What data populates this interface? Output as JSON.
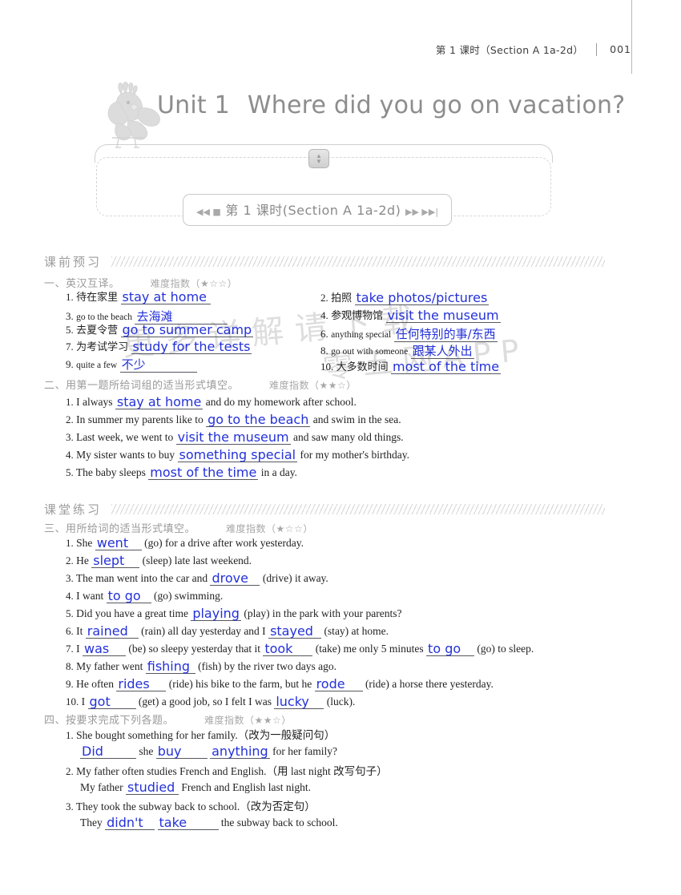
{
  "runhead": {
    "title": "第 1 课时（Section A 1a-2d）",
    "page_number": "001"
  },
  "banner": {
    "unit_number": "Unit 1",
    "unit_title": "Where did you go on vacation?",
    "lesson_pill": "第 1 课时(Section A 1a-2d)",
    "nav_left": "◀◀ ■",
    "nav_right": "▶▶ ▶▶|",
    "bird_icon": "cockatoo-illustration"
  },
  "watermark": {
    "line1": "更多详解请下载",
    "line2": "零五网APP"
  },
  "sections": [
    {
      "label": "课前预习"
    },
    {
      "label": "课堂练习"
    }
  ],
  "parts": [
    {
      "heading": "一、英汉互译。",
      "difficulty": "难度指数（★☆☆）",
      "items_left": [
        {
          "num": "1.",
          "prompt": "待在家里",
          "prompt_style": "cn",
          "answer": "stay at home",
          "answer_style": "en"
        },
        {
          "num": "3.",
          "prompt": "go to the beach",
          "prompt_style": "en-small",
          "answer": "去海滩",
          "answer_style": "cn"
        },
        {
          "num": "5.",
          "prompt": "去夏令营",
          "prompt_style": "cn",
          "answer": "go to summer camp",
          "answer_style": "en"
        },
        {
          "num": "7.",
          "prompt": "为考试学习",
          "prompt_style": "cn",
          "answer": "study for the tests",
          "answer_style": "en"
        },
        {
          "num": "9.",
          "prompt": "quite a few",
          "prompt_style": "en-small",
          "answer": "不少",
          "answer_style": "cn"
        }
      ],
      "items_right": [
        {
          "num": "2.",
          "prompt": "拍照",
          "prompt_style": "cn",
          "answer": "take photos/pictures",
          "answer_style": "en"
        },
        {
          "num": "4.",
          "prompt": "参观博物馆",
          "prompt_style": "cn",
          "answer": "visit the museum",
          "answer_style": "en"
        },
        {
          "num": "6.",
          "prompt": "anything special",
          "prompt_style": "en-small",
          "answer": "任何特别的事/东西",
          "answer_style": "cn"
        },
        {
          "num": "8.",
          "prompt": "go out with someone",
          "prompt_style": "en-small",
          "answer": "跟某人外出",
          "answer_style": "cn"
        },
        {
          "num": "10.",
          "prompt": "大多数时间",
          "prompt_style": "cn",
          "answer": "most of the time",
          "answer_style": "en"
        }
      ]
    },
    {
      "heading": "二、用第一题所给词组的适当形式填空。",
      "difficulty": "难度指数（★★☆）",
      "items": [
        {
          "num": "1.",
          "before": "I always",
          "answer": "stay at home",
          "after": "and do my homework after school."
        },
        {
          "num": "2.",
          "before": "In summer my parents like to",
          "answer": "go to the beach",
          "after": "and swim in the sea."
        },
        {
          "num": "3.",
          "before": "Last week, we went to",
          "answer": "visit the museum",
          "after": "and saw many old things."
        },
        {
          "num": "4.",
          "before": "My sister wants to buy",
          "answer": "something special",
          "after": "for my mother's birthday."
        },
        {
          "num": "5.",
          "before": "The baby sleeps",
          "answer": "most of the time",
          "after": "in a day."
        }
      ]
    },
    {
      "heading": "三、用所给词的适当形式填空。",
      "difficulty": "难度指数（★☆☆）",
      "items": [
        {
          "num": "1.",
          "before": "She",
          "answer": "went",
          "after": "(go) for a drive after work yesterday."
        },
        {
          "num": "2.",
          "before": "He",
          "answer": "slept",
          "after": "(sleep) late last weekend."
        },
        {
          "num": "3.",
          "before": "The man went into the car and",
          "answer": "drove",
          "after": "(drive) it away."
        },
        {
          "num": "4.",
          "before": "I want",
          "answer": "to go",
          "after": "(go) swimming."
        },
        {
          "num": "5.",
          "before": "Did you have a great time",
          "answer": "playing",
          "after": "(play) in the park with your parents?"
        },
        {
          "num": "6.",
          "before": "It",
          "answer": "rained",
          "after": "(rain) all day yesterday and I",
          "answer2": "stayed",
          "after2": "(stay) at home."
        },
        {
          "num": "7.",
          "before": "I",
          "answer": "was",
          "after": "(be) so sleepy yesterday that it",
          "answer2": "took",
          "after2": "(take) me only 5 minutes",
          "answer3": "to go",
          "after3": "(go) to sleep."
        },
        {
          "num": "8.",
          "before": "My father went",
          "answer": "fishing",
          "after": "(fish) by the river two days ago."
        },
        {
          "num": "9.",
          "before": "He often",
          "answer": "rides",
          "after": "(ride) his bike to the farm, but he",
          "answer2": "rode",
          "after2": "(ride) a horse there yesterday."
        },
        {
          "num": "10.",
          "before": "I",
          "answer": "got",
          "after": "(get) a good job, so I felt I was",
          "answer2": "lucky",
          "after2": "(luck)."
        }
      ]
    },
    {
      "heading": "四、按要求完成下列各题。",
      "difficulty": "难度指数（★★☆）",
      "items": [
        {
          "num": "1.",
          "question": "She bought something for her family.（改为一般疑问句）",
          "ans_before": "",
          "answer": "Did",
          "ans_mid": "she",
          "answer2": "buy",
          "answer3": "anything",
          "ans_after": "for her family?"
        },
        {
          "num": "2.",
          "question": "My father often studies French and English.（用 last night 改写句子）",
          "ans_before": "My father",
          "answer": "studied",
          "ans_after": "French and English last night."
        },
        {
          "num": "3.",
          "question": "They took the subway back to school.（改为否定句）",
          "ans_before": "They",
          "answer": "didn't",
          "answer2": "take",
          "ans_after": "the subway back to school."
        }
      ]
    }
  ]
}
